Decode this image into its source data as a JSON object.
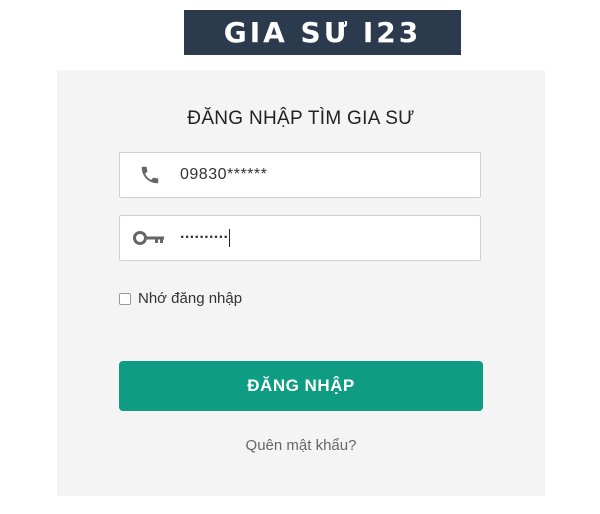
{
  "logo": {
    "text": "GIA SƯ I23"
  },
  "login_form": {
    "title": "ĐĂNG NHẬP TÌM GIA SƯ",
    "phone_value": "09830******",
    "password_value": "··········",
    "remember_label": "Nhớ đăng nhập",
    "remember_checked": false,
    "submit_label": "ĐĂNG NHẬP",
    "forgot_label": "Quên mật khẩu?",
    "phone_icon": "phone-icon",
    "password_icon": "key-icon"
  },
  "colors": {
    "logo_bg": "#2c3a4d",
    "button_bg": "#0e9c82",
    "card_bg": "#f4f4f4"
  }
}
